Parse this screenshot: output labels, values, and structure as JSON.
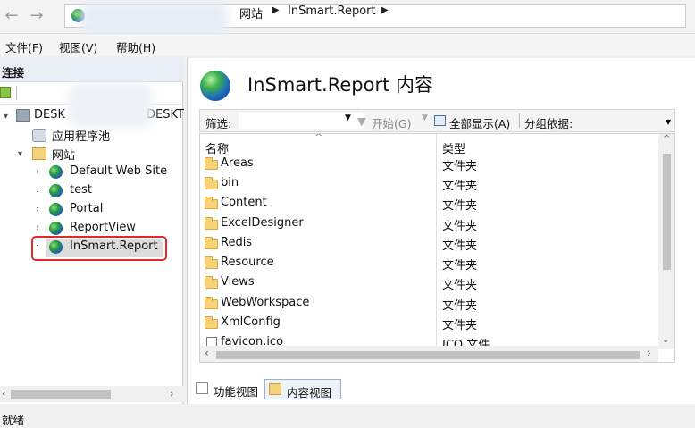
{
  "nav": {
    "back_icon": "back-arrow-icon",
    "forward_icon": "forward-arrow-icon"
  },
  "breadcrumb": {
    "items": [
      "网站",
      "InSmart.Report"
    ]
  },
  "menu": {
    "items": [
      "文件(F)",
      "视图(V)",
      "帮助(H)"
    ]
  },
  "connections": {
    "header": "连接",
    "tree": {
      "root_prefix": "DESK",
      "root_suffix": "DESKT",
      "app_pools": "应用程序池",
      "sites_label": "网站",
      "sites": [
        "Default Web Site",
        "test",
        "Portal",
        "ReportView",
        "InSmart.Report"
      ],
      "selected": "InSmart.Report"
    }
  },
  "content": {
    "title": "InSmart.Report 内容",
    "filter": {
      "label": "筛选:",
      "start": "开始(G)",
      "show_all": "全部显示(A)",
      "group_by": "分组依据:"
    },
    "columns": {
      "name": "名称",
      "type": "类型"
    },
    "rows": [
      {
        "name": "Areas",
        "type": "文件夹"
      },
      {
        "name": "bin",
        "type": "文件夹"
      },
      {
        "name": "Content",
        "type": "文件夹"
      },
      {
        "name": "ExcelDesigner",
        "type": "文件夹"
      },
      {
        "name": "Redis",
        "type": "文件夹"
      },
      {
        "name": "Resource",
        "type": "文件夹"
      },
      {
        "name": "Views",
        "type": "文件夹"
      },
      {
        "name": "WebWorkspace",
        "type": "文件夹"
      },
      {
        "name": "XmlConfig",
        "type": "文件夹"
      },
      {
        "name": "favicon.ico",
        "type": "ICO 文件"
      }
    ]
  },
  "view_tabs": {
    "features": "功能视图",
    "content": "内容视图",
    "active": "内容视图"
  },
  "status": {
    "text": "就绪"
  }
}
